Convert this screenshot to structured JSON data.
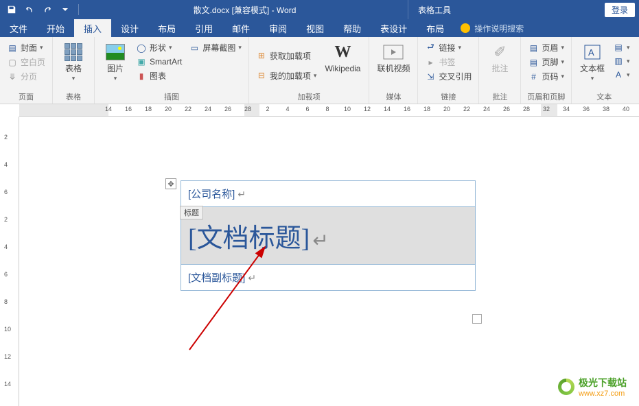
{
  "titlebar": {
    "doc": "散文.docx [兼容模式] - Word",
    "tool_tab": "表格工具",
    "login": "登录"
  },
  "tabs": {
    "file": "文件",
    "home": "开始",
    "insert": "插入",
    "design": "设计",
    "layout": "布局",
    "references": "引用",
    "mailings": "邮件",
    "review": "审阅",
    "view": "视图",
    "help": "帮助",
    "tdesign": "表设计",
    "tlayout": "布局"
  },
  "tellme": "操作说明搜索",
  "ribbon": {
    "pages": {
      "cover": "封面",
      "blank": "空白页",
      "break": "分页",
      "label": "页面"
    },
    "tables": {
      "btn": "表格",
      "label": "表格"
    },
    "illus": {
      "pic": "图片",
      "shapes": "形状",
      "smartart": "SmartArt",
      "chart": "图表",
      "screenshot": "屏幕截图",
      "label": "插图"
    },
    "addins": {
      "get": "获取加载项",
      "my": "我的加载项",
      "wiki": "Wikipedia",
      "label": "加载项"
    },
    "media": {
      "btn": "联机视频",
      "label": "媒体"
    },
    "links": {
      "link": "链接",
      "bookmark": "书签",
      "xref": "交叉引用",
      "label": "链接"
    },
    "comments": {
      "btn": "批注",
      "label": "批注"
    },
    "hf": {
      "header": "页眉",
      "footer": "页脚",
      "number": "页码",
      "label": "页眉和页脚"
    },
    "text": {
      "box": "文本框",
      "label": "文本"
    }
  },
  "ruler_h": [
    14,
    16,
    18,
    20,
    22,
    24,
    26,
    28,
    2,
    4,
    6,
    8,
    10,
    12,
    14,
    16,
    18,
    20,
    22,
    24,
    26,
    28,
    32,
    34,
    36,
    38,
    40
  ],
  "ruler_v": [
    2,
    4,
    6,
    2,
    4,
    6,
    8,
    10,
    12,
    14
  ],
  "doc": {
    "company": "[公司名称]",
    "tag": "标题",
    "title": "[文档标题]",
    "subtitle": "[文档副标题]"
  },
  "watermark": {
    "name": "极光下载站",
    "url": "www.xz7.com"
  }
}
